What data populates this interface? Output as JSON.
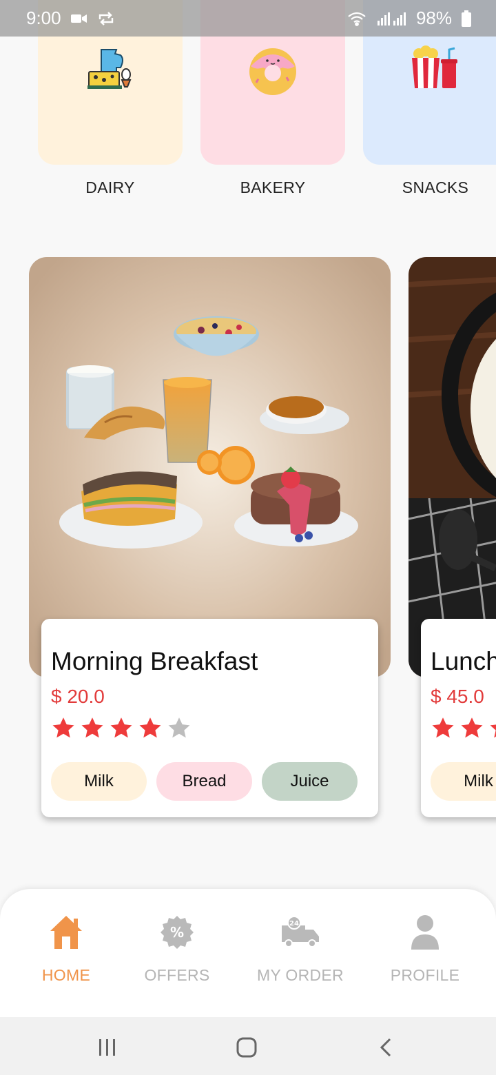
{
  "status_bar": {
    "time": "9:00",
    "battery": "98%"
  },
  "categories": [
    {
      "label": "DAIRY",
      "color": "#fff2dc",
      "icon": "dairy-icon"
    },
    {
      "label": "BAKERY",
      "color": "#fedde4",
      "icon": "donut-icon"
    },
    {
      "label": "SNACKS",
      "color": "#dceafd",
      "icon": "popcorn-icon"
    }
  ],
  "products": [
    {
      "title": "Morning Breakfast",
      "price": "$ 20.0",
      "rating": 4,
      "rating_max": 5,
      "tags": [
        {
          "label": "Milk",
          "color": "#fff2dc"
        },
        {
          "label": "Bread",
          "color": "#fedde4"
        },
        {
          "label": "Juice",
          "color": "#c3d4c7"
        }
      ]
    },
    {
      "title": "Lunch",
      "price": "$ 45.0",
      "tags": [
        {
          "label": "Milk",
          "color": "#fff2dc"
        }
      ]
    }
  ],
  "bottom_nav": [
    {
      "label": "HOME",
      "icon": "home-icon",
      "active": true
    },
    {
      "label": "OFFERS",
      "icon": "offers-icon",
      "active": false
    },
    {
      "label": "MY ORDER",
      "icon": "delivery-truck-icon",
      "active": false
    },
    {
      "label": "PROFILE",
      "icon": "profile-icon",
      "active": false
    }
  ],
  "colors": {
    "accent": "#f0944a",
    "price": "#e23b3b",
    "star_on": "#ee3b3b",
    "star_off": "#bdbdbd"
  }
}
